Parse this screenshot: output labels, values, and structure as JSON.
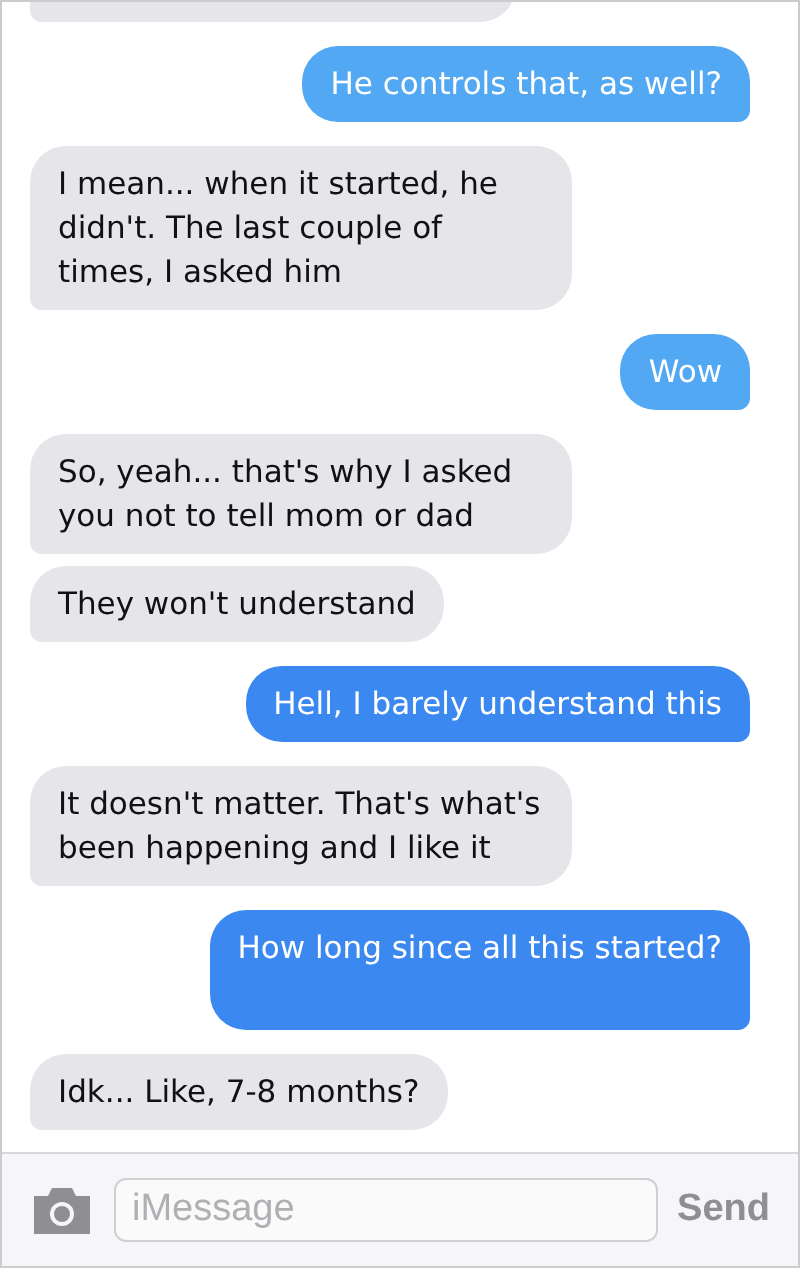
{
  "messages": [
    {
      "kind": "received",
      "partial": true
    },
    {
      "kind": "sent",
      "text": "He controls that, as well?",
      "color": "#52a8f2"
    },
    {
      "kind": "received",
      "text": "I mean... when it started, he didn't. The last couple of times, I asked him"
    },
    {
      "kind": "sent",
      "text": "Wow",
      "color": "#52a8f2"
    },
    {
      "kind": "received",
      "text": "So, yeah... that's why I asked you not to tell mom or dad"
    },
    {
      "kind": "received",
      "text": "They won't understand"
    },
    {
      "kind": "sent",
      "text": "Hell, I barely understand this",
      "color": "#3b89f0"
    },
    {
      "kind": "received",
      "text": "It doesn't matter. That's what's been happening and I like it"
    },
    {
      "kind": "sent",
      "text": "How long since all this started?",
      "color": "#3b89f0",
      "tall": true
    },
    {
      "kind": "received",
      "text": "Idk... Like, 7-8 months?"
    }
  ],
  "composer": {
    "placeholder": "iMessage",
    "send": "Send"
  }
}
